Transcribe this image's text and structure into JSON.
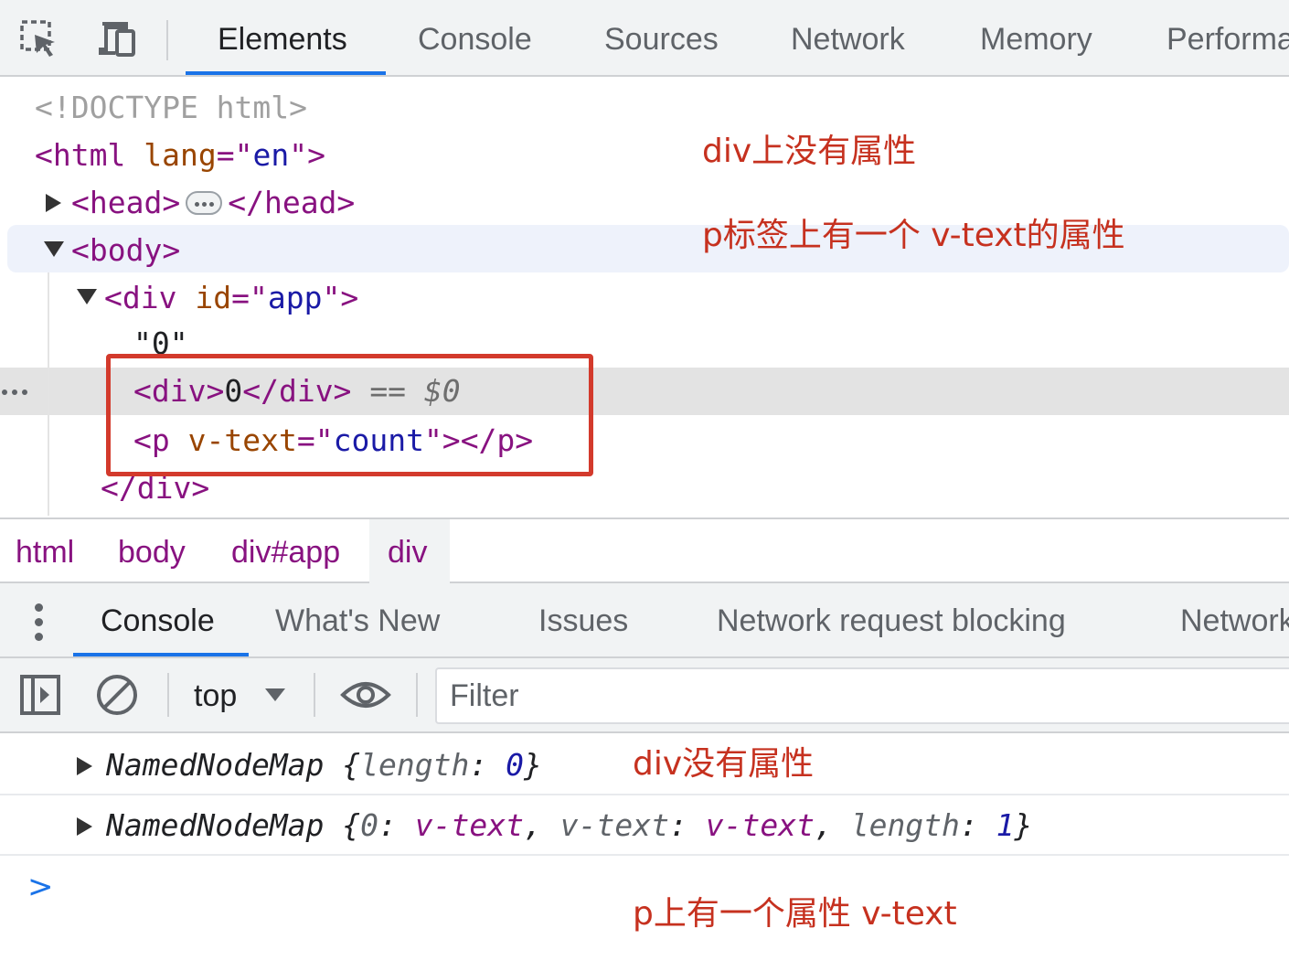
{
  "top_tabs": [
    "Elements",
    "Console",
    "Sources",
    "Network",
    "Memory",
    "Performance"
  ],
  "icons": {
    "inspect": "inspect-element-icon",
    "device": "device-toolbar-icon"
  },
  "dom_tree": {
    "doctype": "<!DOCTYPE html>",
    "html_open": "<html",
    "html_attr": "lang",
    "html_eq_open": "=\"",
    "html_val": "en",
    "html_close_quote": "\">",
    "head_open": "<head>",
    "head_close": "</head>",
    "body_open": "<body>",
    "div_open": "<div",
    "div_attr": "id",
    "div_eq_open": "=\"",
    "div_val": "app",
    "div_close_quote": "\">",
    "text_node": "\"0\"",
    "inner_div_open": "<div>",
    "inner_div_text": "0",
    "inner_div_close": "</div>",
    "selected_marker": "== $0",
    "p_open": "<p",
    "p_attr": "v-text",
    "p_eq_open": "=\"",
    "p_val": "count",
    "p_close_quote": "\">",
    "p_close": "</p>",
    "div_close": "</div>"
  },
  "annotations": {
    "a1": "div上没有属性",
    "a2": "p标签上有一个 v-text的属性",
    "a3": "div没有属性",
    "a4": "p上有一个属性 v-text"
  },
  "breadcrumbs": [
    "html",
    "body",
    "div#app",
    "div"
  ],
  "drawer_tabs": [
    "Console",
    "What's New",
    "Issues",
    "Network request blocking",
    "Network conditions"
  ],
  "console_toolbar": {
    "context": "top",
    "filter_placeholder": "Filter"
  },
  "console_output": {
    "line1": {
      "name": "NamedNodeMap",
      "open": " {",
      "key": "length",
      "colon": ": ",
      "value": "0",
      "close": "}"
    },
    "line2": {
      "name": "NamedNodeMap",
      "open": " {",
      "k0": "0",
      "c0": ": ",
      "v0": "v-text",
      "sep1": ", ",
      "k1": "v-text",
      "c1": ": ",
      "v1": "v-text",
      "sep2": ", ",
      "k2": "length",
      "c2": ": ",
      "v2": "1",
      "close": "}"
    },
    "prompt": ">"
  }
}
